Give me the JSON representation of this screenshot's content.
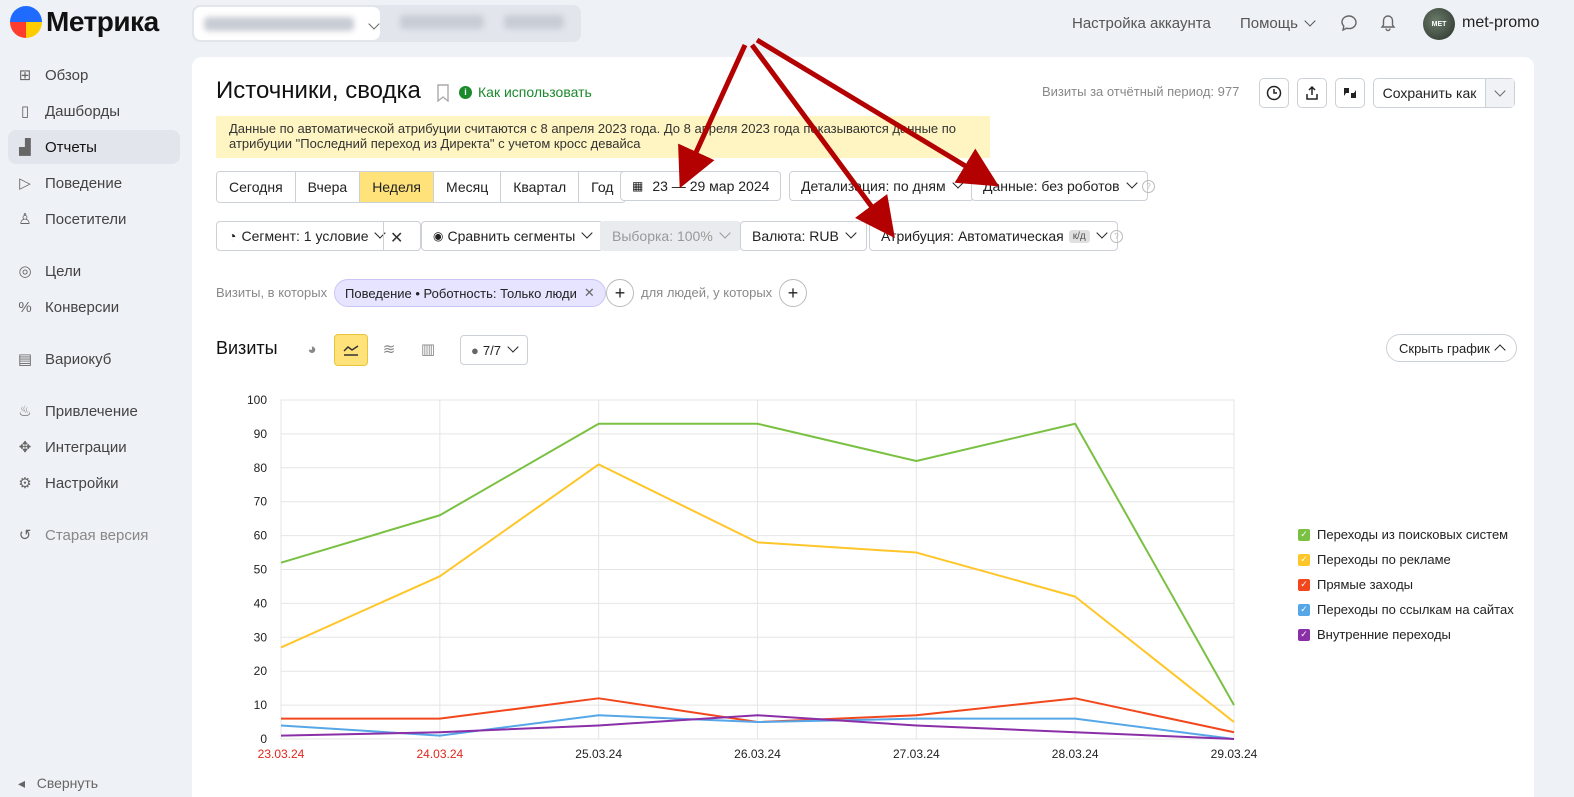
{
  "app": {
    "logo_text": "Метрика"
  },
  "topbar": {
    "account_settings": "Настройка аккаунта",
    "help": "Помощь",
    "username": "met-promo",
    "avatar_text": "MET"
  },
  "sidebar": {
    "items": [
      {
        "label": "Обзор",
        "icon": "grid-icon"
      },
      {
        "label": "Дашборды",
        "icon": "dashboard-icon"
      },
      {
        "label": "Отчеты",
        "icon": "bar-chart-icon",
        "active": true
      },
      {
        "label": "Поведение",
        "icon": "play-icon"
      },
      {
        "label": "Посетители",
        "icon": "user-icon"
      },
      {
        "label": "Цели",
        "icon": "target-icon"
      },
      {
        "label": "Конверсии",
        "icon": "percent-icon"
      },
      {
        "label": "Вариокуб",
        "icon": "table-icon"
      },
      {
        "label": "Привлечение",
        "icon": "flame-icon"
      },
      {
        "label": "Интеграции",
        "icon": "puzzle-icon"
      },
      {
        "label": "Настройки",
        "icon": "gear-icon"
      },
      {
        "label": "Старая версия",
        "icon": "undo-icon"
      }
    ],
    "collapse": "Свернуть"
  },
  "header": {
    "title": "Источники, сводка",
    "how_to": "Как использовать",
    "visits_total": "Визиты за отчётный период: 977",
    "save_as": "Сохранить как"
  },
  "notice": {
    "line1": "Данные по автоматической атрибуции считаются с 8 апреля 2023 года. До 8 апреля 2023 года показываются данные по",
    "line2": "атрибуции \"Последний переход из Директа\" с учетом кросс девайса"
  },
  "periods": [
    "Сегодня",
    "Вчера",
    "Неделя",
    "Месяц",
    "Квартал",
    "Год"
  ],
  "selected_period": "Неделя",
  "controls": {
    "date_range": "23 — 29 мар 2024",
    "detail": "Детализация: по дням",
    "data": "Данные: без роботов",
    "segment": "Сегмент: 1 условие",
    "compare": "Сравнить сегменты",
    "sample": "Выборка: 100%",
    "currency": "Валюта: RUB",
    "attribution": "Атрибуция: Автоматическая",
    "attribution_badge": "к/д"
  },
  "filters": {
    "visits_where": "Визиты, в которых",
    "chip": "Поведение • Роботность: Только люди",
    "people_where": "для людей, у которых"
  },
  "chart_header": {
    "title": "Визиты",
    "series_count": "7/7",
    "hide_chart": "Скрыть график"
  },
  "colors": {
    "accent": "#ffe27a",
    "weekend_tick": "#e0261b",
    "annotation_arrow": "#b30000"
  },
  "chart_data": {
    "type": "line",
    "categories": [
      "23.03.24",
      "24.03.24",
      "25.03.24",
      "26.03.24",
      "27.03.24",
      "28.03.24",
      "29.03.24"
    ],
    "weekend_categories": [
      "23.03.24",
      "24.03.24"
    ],
    "ylim": [
      0,
      100
    ],
    "yticks": [
      0,
      10,
      20,
      30,
      40,
      50,
      60,
      70,
      80,
      90,
      100
    ],
    "grid": true,
    "legend_position": "right",
    "series": [
      {
        "name": "Переходы из поисковых систем",
        "color": "#7ac143",
        "values": [
          52,
          66,
          93,
          93,
          82,
          93,
          10
        ]
      },
      {
        "name": "Переходы по рекламе",
        "color": "#ffc629",
        "values": [
          27,
          48,
          81,
          58,
          55,
          42,
          5
        ]
      },
      {
        "name": "Прямые заходы",
        "color": "#f2471c",
        "values": [
          6,
          6,
          12,
          5,
          7,
          12,
          2
        ]
      },
      {
        "name": "Переходы по ссылкам на сайтах",
        "color": "#56a7e8",
        "values": [
          4,
          1,
          7,
          5,
          6,
          6,
          0
        ]
      },
      {
        "name": "Внутренние переходы",
        "color": "#8b2fa8",
        "values": [
          1,
          2,
          4,
          7,
          4,
          2,
          0
        ]
      }
    ]
  }
}
